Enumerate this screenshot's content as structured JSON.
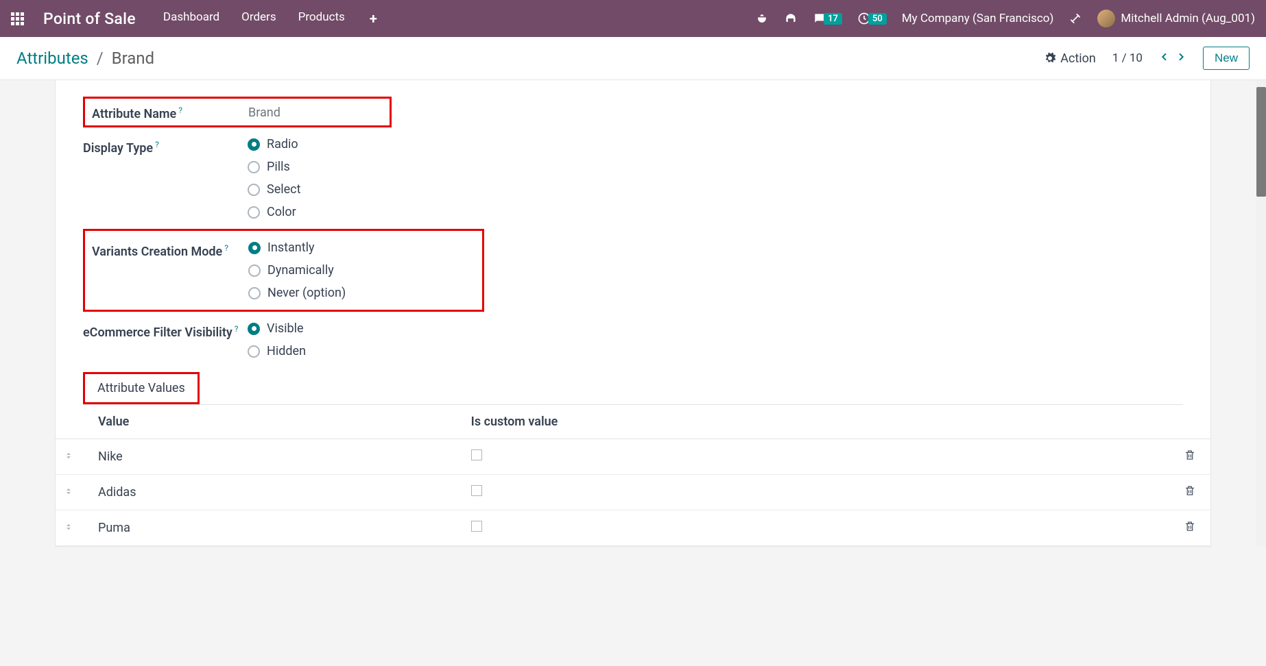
{
  "topbar": {
    "app_title": "Point of Sale",
    "nav": [
      "Dashboard",
      "Orders",
      "Products"
    ],
    "msg_badge": "17",
    "activity_badge": "50",
    "company": "My Company (San Francisco)",
    "user": "Mitchell Admin (Aug_001)"
  },
  "actionbar": {
    "breadcrumb_parent": "Attributes",
    "breadcrumb_current": "Brand",
    "action_label": "Action",
    "pager": "1 / 10",
    "new_label": "New"
  },
  "form": {
    "attribute_name": {
      "label": "Attribute Name",
      "value": "Brand"
    },
    "display_type": {
      "label": "Display Type",
      "options": [
        "Radio",
        "Pills",
        "Select",
        "Color"
      ],
      "selected": "Radio"
    },
    "variants_mode": {
      "label": "Variants Creation Mode",
      "options": [
        "Instantly",
        "Dynamically",
        "Never (option)"
      ],
      "selected": "Instantly"
    },
    "ecommerce_filter": {
      "label": "eCommerce Filter Visibility",
      "options": [
        "Visible",
        "Hidden"
      ],
      "selected": "Visible"
    },
    "tab_label": "Attribute Values",
    "table": {
      "headers": {
        "value": "Value",
        "custom": "Is custom value"
      },
      "rows": [
        {
          "value": "Nike",
          "custom": false
        },
        {
          "value": "Adidas",
          "custom": false
        },
        {
          "value": "Puma",
          "custom": false
        }
      ]
    }
  }
}
